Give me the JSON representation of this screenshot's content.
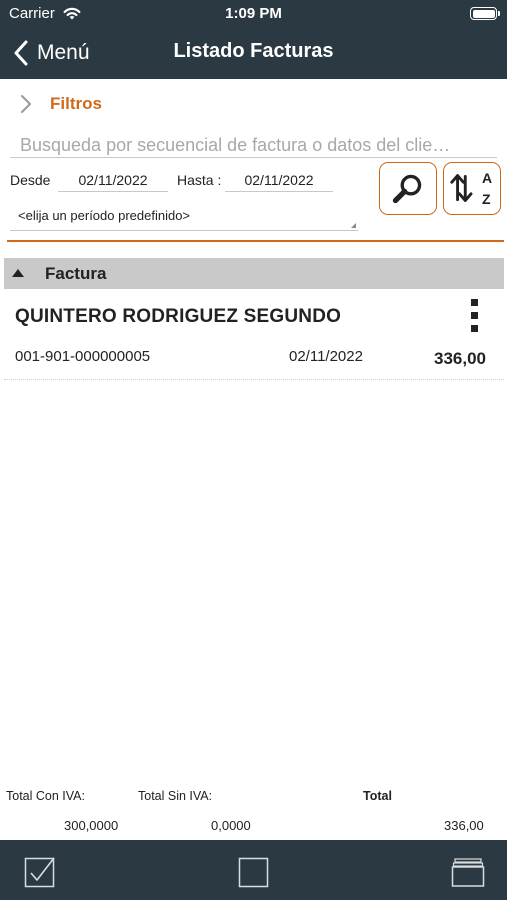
{
  "status_bar": {
    "carrier": "Carrier",
    "time": "1:09 PM"
  },
  "nav": {
    "back_label": "Menú",
    "title": "Listado Facturas"
  },
  "filters": {
    "label": "Filtros",
    "search_placeholder": "Busqueda por secuencial de factura o datos del clie…",
    "desde_label": "Desde",
    "desde_value": "02/11/2022",
    "hasta_label": "Hasta :",
    "hasta_value": "02/11/2022",
    "period_value": "<elija un período predefinido>",
    "sort_top_letter": "A",
    "sort_bottom_letter": "Z"
  },
  "group": {
    "title": "Factura"
  },
  "invoices": [
    {
      "client": "QUINTERO RODRIGUEZ SEGUNDO",
      "number": "001-901-000000005",
      "date": "02/11/2022",
      "amount": "336,00"
    }
  ],
  "totals": {
    "con_iva_label": "Total Con IVA:",
    "sin_iva_label": "Total Sin IVA:",
    "total_label": "Total",
    "con_iva_value": "300,0000",
    "sin_iva_value": "0,0000",
    "total_value": "336,00"
  },
  "colors": {
    "nav_bg": "#2b3a42",
    "accent": "#d06a1a",
    "group_bg": "#c9c9c9"
  },
  "icons": {
    "search_button": "search-icon",
    "sort_button": "sort-az-icon",
    "toolbar": [
      "checkbox-checked-icon",
      "checkbox-empty-icon",
      "windows-stack-icon"
    ]
  }
}
